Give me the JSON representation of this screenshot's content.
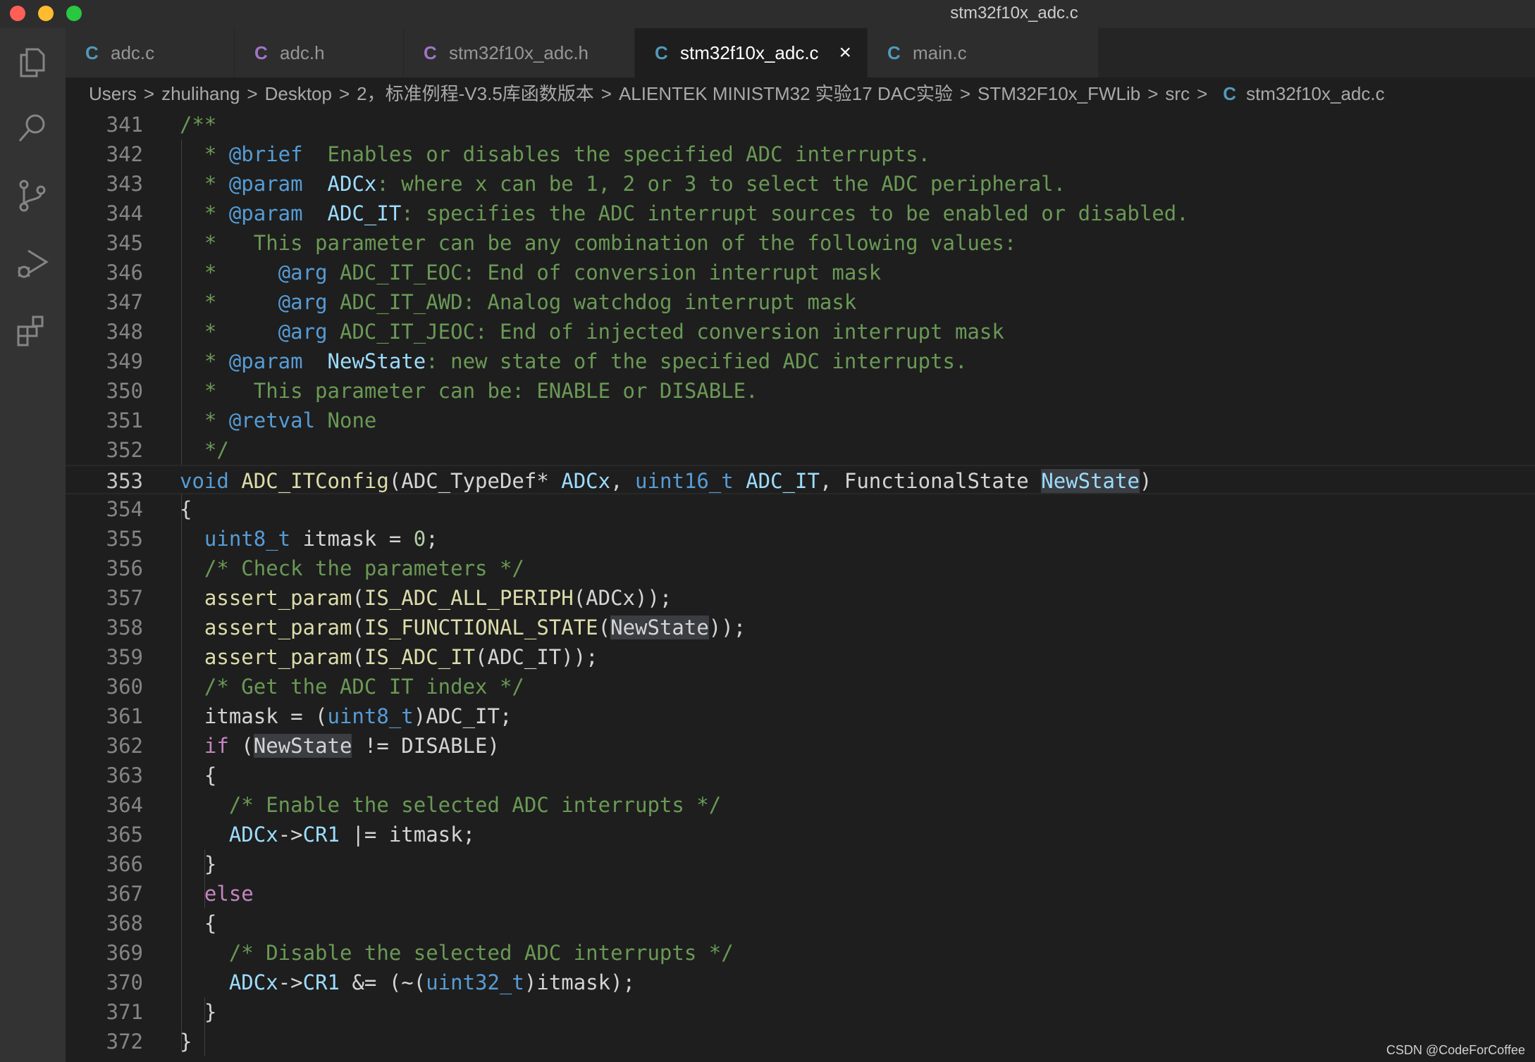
{
  "window": {
    "title": "stm32f10x_adc.c"
  },
  "activity_bar": [
    "explorer-icon",
    "search-icon",
    "source-control-icon",
    "run-debug-icon",
    "extensions-icon"
  ],
  "tabs": [
    {
      "glyph": "C",
      "label": "adc.c",
      "glyph_color": "#519aba"
    },
    {
      "glyph": "C",
      "label": "adc.h",
      "glyph_color": "#a074c4"
    },
    {
      "glyph": "C",
      "label": "stm32f10x_adc.h",
      "glyph_color": "#a074c4"
    },
    {
      "glyph": "C",
      "label": "stm32f10x_adc.c",
      "glyph_color": "#519aba",
      "close": "×"
    },
    {
      "glyph": "C",
      "label": "main.c",
      "glyph_color": "#519aba"
    }
  ],
  "breadcrumb": {
    "items": [
      "Users",
      "zhulihang",
      "Desktop",
      "2，标准例程-V3.5库函数版本",
      "ALIENTEK MINISTM32 实验17 DAC实验",
      "STM32F10x_FWLib",
      "src"
    ],
    "file_glyph": "C",
    "file": "stm32f10x_adc.c",
    "separator": ">"
  },
  "editor": {
    "current_line": "353",
    "lines": [
      {
        "n": "341",
        "t": "/**"
      },
      {
        "n": "342",
        "t": "  * @brief  Enables or disables the specified ADC interrupts."
      },
      {
        "n": "343",
        "t": "  * @param  ADCx: where x can be 1, 2 or 3 to select the ADC peripheral."
      },
      {
        "n": "344",
        "t": "  * @param  ADC_IT: specifies the ADC interrupt sources to be enabled or disabled."
      },
      {
        "n": "345",
        "t": "  *   This parameter can be any combination of the following values:"
      },
      {
        "n": "346",
        "t": "  *     @arg ADC_IT_EOC: End of conversion interrupt mask"
      },
      {
        "n": "347",
        "t": "  *     @arg ADC_IT_AWD: Analog watchdog interrupt mask"
      },
      {
        "n": "348",
        "t": "  *     @arg ADC_IT_JEOC: End of injected conversion interrupt mask"
      },
      {
        "n": "349",
        "t": "  * @param  NewState: new state of the specified ADC interrupts."
      },
      {
        "n": "350",
        "t": "  *   This parameter can be: ENABLE or DISABLE."
      },
      {
        "n": "351",
        "t": "  * @retval None"
      },
      {
        "n": "352",
        "t": "  */"
      },
      {
        "n": "353",
        "t": "void ADC_ITConfig(ADC_TypeDef* ADCx, uint16_t ADC_IT, FunctionalState NewState)"
      },
      {
        "n": "354",
        "t": "{"
      },
      {
        "n": "355",
        "t": "  uint8_t itmask = 0;"
      },
      {
        "n": "356",
        "t": "  /* Check the parameters */"
      },
      {
        "n": "357",
        "t": "  assert_param(IS_ADC_ALL_PERIPH(ADCx));"
      },
      {
        "n": "358",
        "t": "  assert_param(IS_FUNCTIONAL_STATE(NewState));"
      },
      {
        "n": "359",
        "t": "  assert_param(IS_ADC_IT(ADC_IT));"
      },
      {
        "n": "360",
        "t": "  /* Get the ADC IT index */"
      },
      {
        "n": "361",
        "t": "  itmask = (uint8_t)ADC_IT;"
      },
      {
        "n": "362",
        "t": "  if (NewState != DISABLE)"
      },
      {
        "n": "363",
        "t": "  {"
      },
      {
        "n": "364",
        "t": "    /* Enable the selected ADC interrupts */"
      },
      {
        "n": "365",
        "t": "    ADCx->CR1 |= itmask;"
      },
      {
        "n": "366",
        "t": "  }"
      },
      {
        "n": "367",
        "t": "  else"
      },
      {
        "n": "368",
        "t": "  {"
      },
      {
        "n": "369",
        "t": "    /* Disable the selected ADC interrupts */"
      },
      {
        "n": "370",
        "t": "    ADCx->CR1 &= (~(uint32_t)itmask);"
      },
      {
        "n": "371",
        "t": "  }"
      },
      {
        "n": "372",
        "t": "}"
      }
    ]
  },
  "watermark": "CSDN @CodeForCoffee",
  "colors": {
    "background": "#1e1e1e",
    "comment": "#6a9955",
    "keyword": "#569cd6",
    "function": "#dcdcaa",
    "variable": "#9cdcfe",
    "number": "#b5cea8",
    "control": "#c586c0"
  }
}
